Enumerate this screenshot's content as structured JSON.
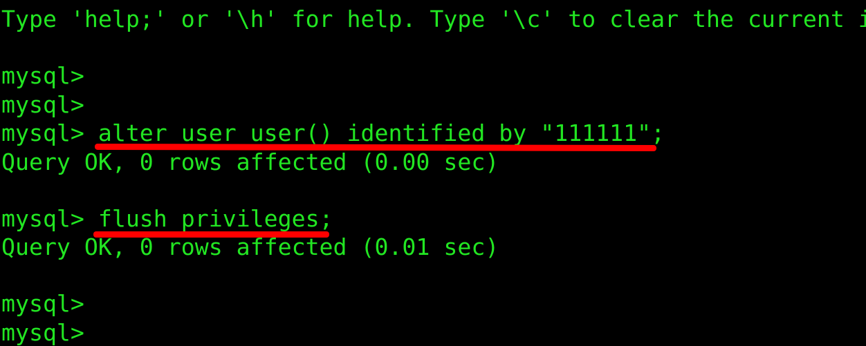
{
  "terminal": {
    "text_color": "#22e622",
    "background_color": "#000000",
    "annotation_color": "#ff0000",
    "lines": [
      "Type 'help;' or '\\h' for help. Type '\\c' to clear the current i",
      "",
      "mysql>",
      "mysql>",
      "mysql> alter user user() identified by \"111111\";",
      "Query OK, 0 rows affected (0.00 sec)",
      "",
      "mysql> flush privileges;",
      "Query OK, 0 rows affected (0.01 sec)",
      "",
      "mysql>",
      "mysql>"
    ]
  }
}
